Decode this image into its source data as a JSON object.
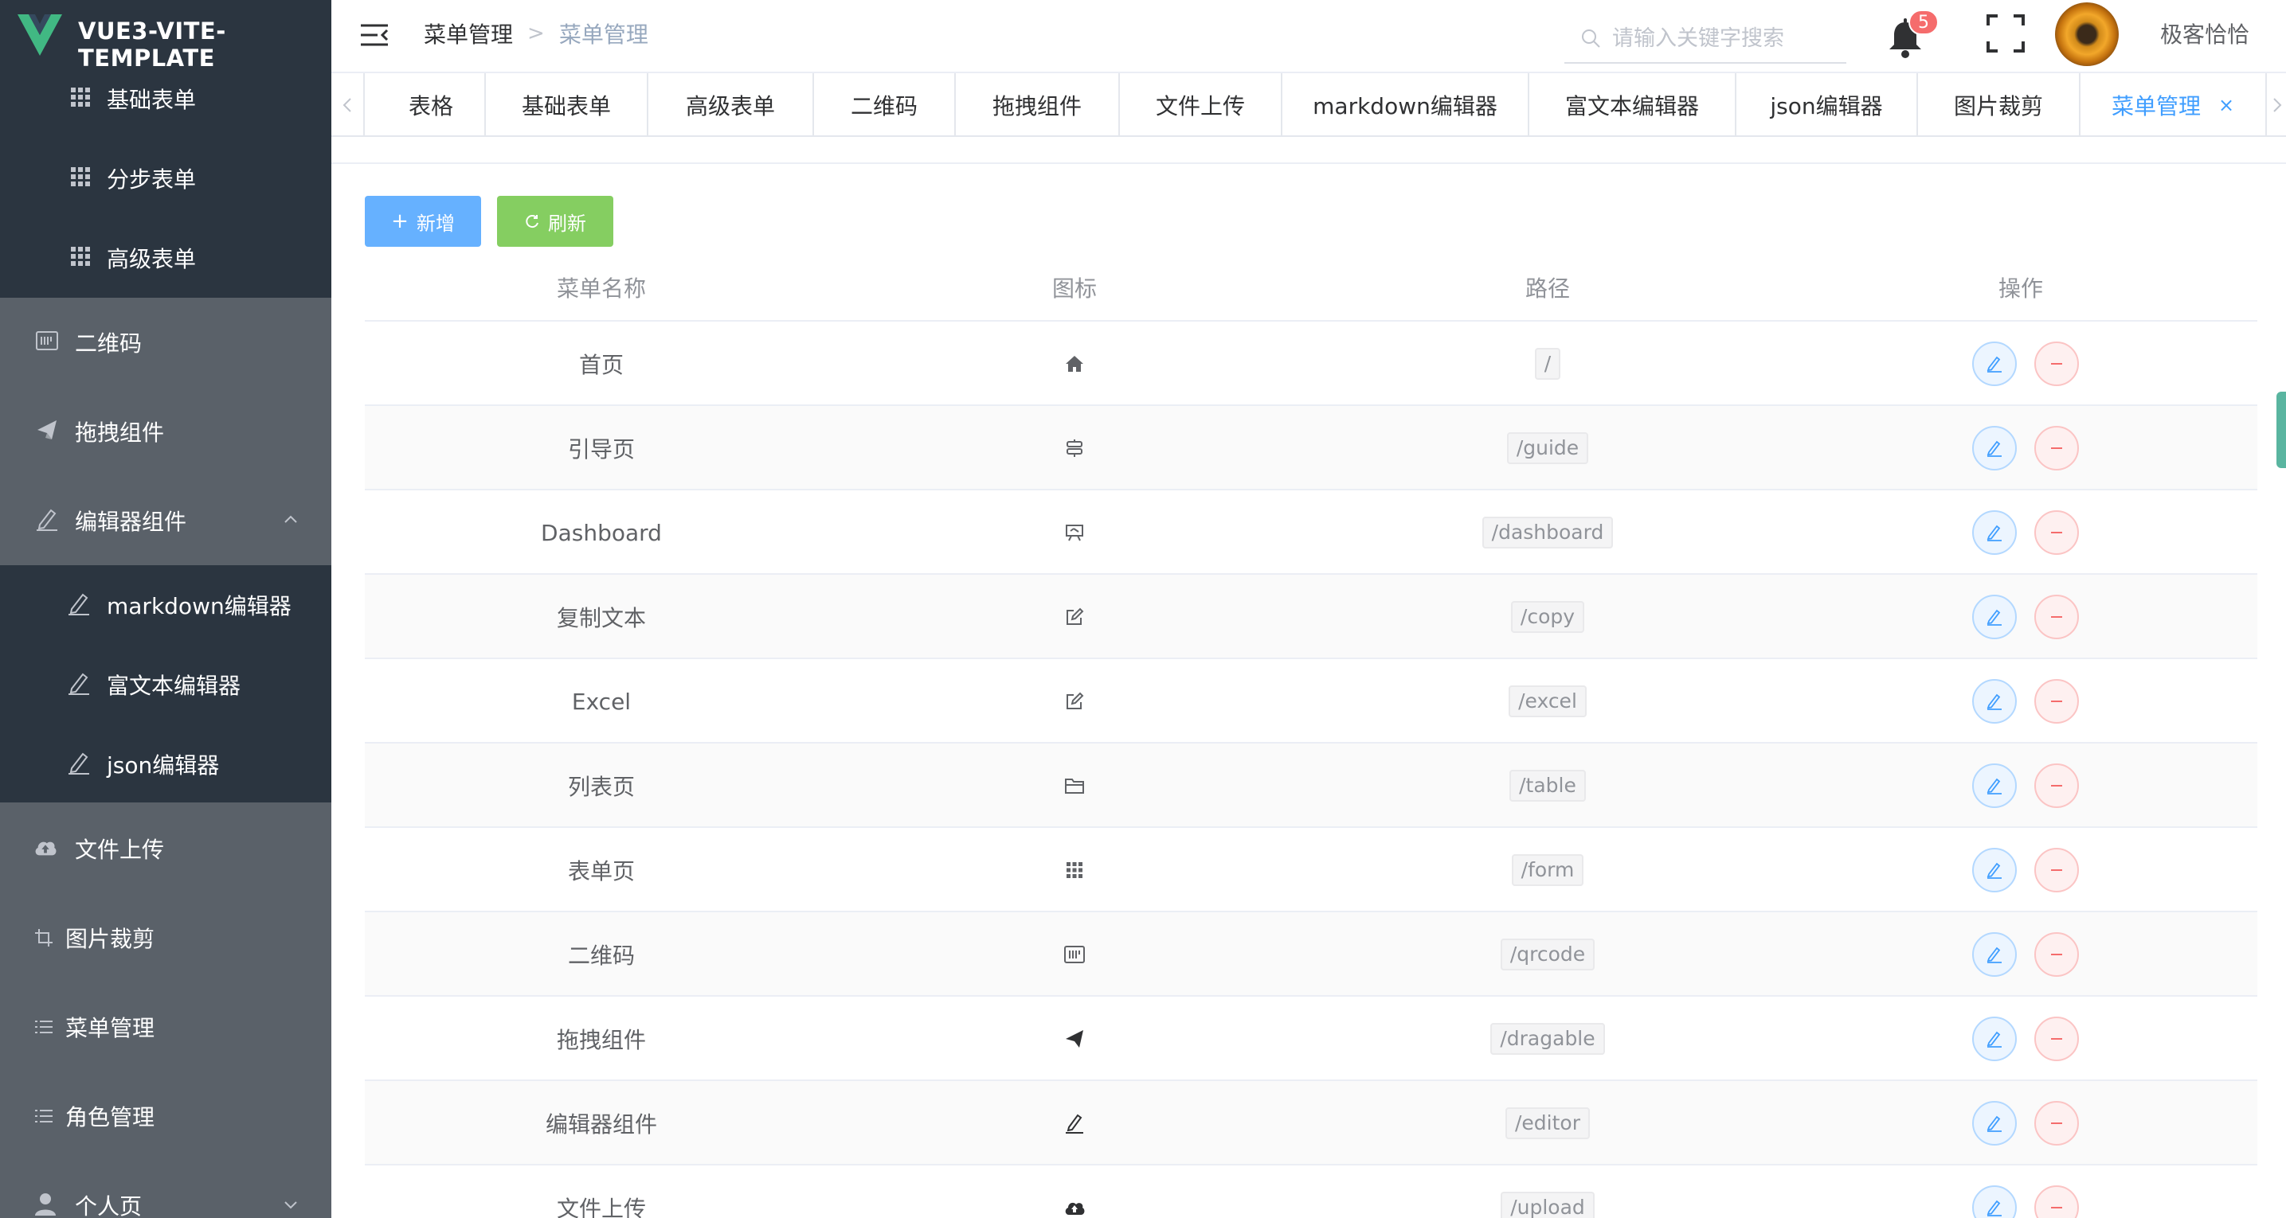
{
  "app": {
    "title": "VUE3-VITE-TEMPLATE"
  },
  "sidebar": {
    "items": [
      {
        "label": "基础表单",
        "icon": "grid-icon"
      },
      {
        "label": "分步表单",
        "icon": "grid-icon"
      },
      {
        "label": "高级表单",
        "icon": "grid-icon"
      },
      {
        "label": "二维码",
        "icon": "qrcode-icon"
      },
      {
        "label": "拖拽组件",
        "icon": "paper-plane-icon"
      },
      {
        "label": "编辑器组件",
        "icon": "pen-icon",
        "expanded": true
      },
      {
        "label": "markdown编辑器",
        "icon": "pen-icon"
      },
      {
        "label": "富文本编辑器",
        "icon": "pen-icon"
      },
      {
        "label": "json编辑器",
        "icon": "pen-icon"
      },
      {
        "label": "文件上传",
        "icon": "cloud-upload-icon"
      },
      {
        "label": "图片裁剪",
        "icon": "crop-icon"
      },
      {
        "label": "菜单管理",
        "icon": "list-icon"
      },
      {
        "label": "角色管理",
        "icon": "list-icon"
      },
      {
        "label": "个人页",
        "icon": "user-icon",
        "expanded": false
      }
    ]
  },
  "header": {
    "breadcrumb": [
      "菜单管理",
      "菜单管理"
    ],
    "search_placeholder": "请输入关键字搜索",
    "notification_count": "5",
    "username": "极客恰恰"
  },
  "tabs": [
    {
      "label": "表格"
    },
    {
      "label": "基础表单"
    },
    {
      "label": "高级表单"
    },
    {
      "label": "二维码"
    },
    {
      "label": "拖拽组件"
    },
    {
      "label": "文件上传"
    },
    {
      "label": "markdown编辑器"
    },
    {
      "label": "富文本编辑器"
    },
    {
      "label": "json编辑器"
    },
    {
      "label": "图片裁剪"
    },
    {
      "label": "菜单管理",
      "active": true,
      "close": "×"
    }
  ],
  "toolbar": {
    "add_label": "新增",
    "refresh_label": "刷新"
  },
  "table": {
    "columns": [
      "菜单名称",
      "图标",
      "路径",
      "操作"
    ],
    "rows": [
      {
        "name": "首页",
        "icon": "home-icon",
        "path": "/"
      },
      {
        "name": "引导页",
        "icon": "guide-icon",
        "path": "/guide"
      },
      {
        "name": "Dashboard",
        "icon": "presentation-icon",
        "path": "/dashboard"
      },
      {
        "name": "复制文本",
        "icon": "edit-square-icon",
        "path": "/copy"
      },
      {
        "name": "Excel",
        "icon": "edit-square-icon",
        "path": "/excel"
      },
      {
        "name": "列表页",
        "icon": "folder-icon",
        "path": "/table"
      },
      {
        "name": "表单页",
        "icon": "grid-icon",
        "path": "/form"
      },
      {
        "name": "二维码",
        "icon": "qrcode-icon",
        "path": "/qrcode"
      },
      {
        "name": "拖拽组件",
        "icon": "paper-plane-icon",
        "path": "/dragable"
      },
      {
        "name": "编辑器组件",
        "icon": "pen-icon",
        "path": "/editor"
      },
      {
        "name": "文件上传",
        "icon": "cloud-upload-icon",
        "path": "/upload"
      }
    ]
  },
  "colors": {
    "sidebar_dark": "#2b3540",
    "sidebar_light": "#5a6169",
    "primary": "#409eff",
    "success": "#85ce61",
    "danger": "#f56c6c"
  }
}
